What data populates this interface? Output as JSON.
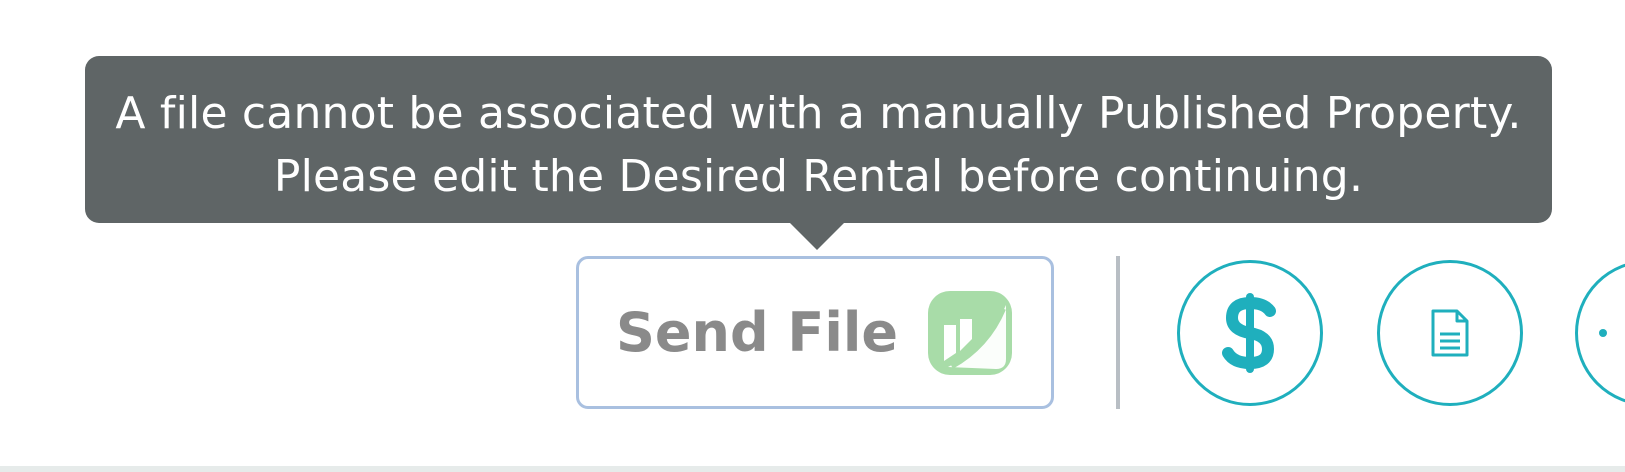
{
  "tooltip": {
    "line1": "A file cannot be associated with a manually Published Property.",
    "line2": "Please edit the Desired Rental before continuing.",
    "background": "#5f6566",
    "text_color": "#ffffff"
  },
  "send_file_button": {
    "label": "Send File",
    "state": "disabled",
    "border_color": "#a9c0e0",
    "label_color": "#8a8a8a",
    "logo_icon": "brand-leaf-icon",
    "logo_color": "#a8dca8"
  },
  "action_buttons": [
    {
      "name": "payment",
      "icon": "dollar-icon"
    },
    {
      "name": "document",
      "icon": "document-icon"
    },
    {
      "name": "more",
      "icon": "partially-visible-icon"
    }
  ],
  "colors": {
    "accent": "#1fafbd",
    "divider": "#b8bec4",
    "bottom_bar": "#e6ebea"
  }
}
